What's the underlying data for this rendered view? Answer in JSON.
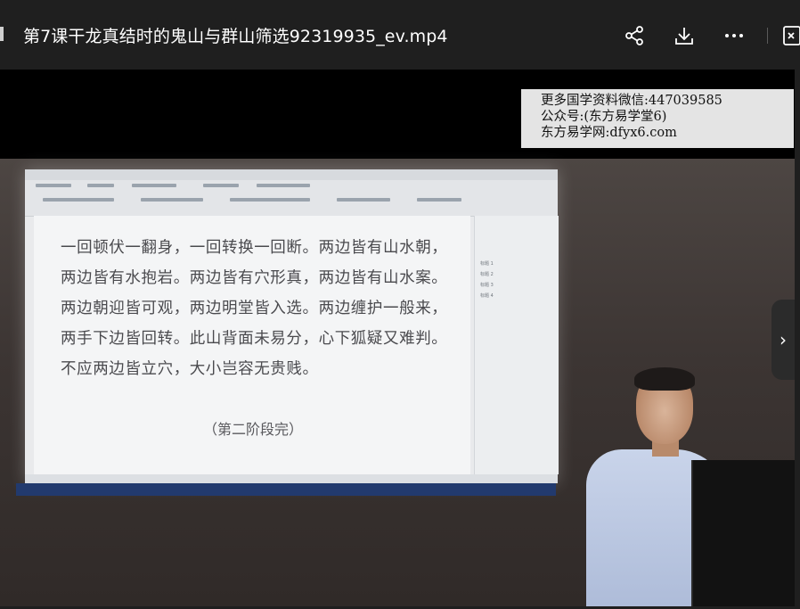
{
  "window": {
    "title": "第7课干龙真结时的鬼山与群山筛选92319935_ev.mp4",
    "actions": [
      {
        "name": "share",
        "icon": "share-icon"
      },
      {
        "name": "download",
        "icon": "download-icon"
      },
      {
        "name": "more",
        "icon": "more-icon"
      },
      {
        "name": "exit",
        "icon": "exit-icon"
      }
    ]
  },
  "video": {
    "watermark": {
      "line1": "更多国学资料微信:447039585",
      "line2": "公众号:(东方易学堂6)",
      "line3": "东方易学网:dfyx6.com"
    },
    "document_text": {
      "line1": "一回顿伏一翻身，一回转换一回断。两边皆有山水朝，",
      "line2": "两边皆有水抱岩。两边皆有穴形真，两边皆有山水案。",
      "line3": "两边朝迎皆可观，两边明堂皆入选。两边缠护一般来，",
      "line4": "两手下边皆回转。此山背面未易分，心下狐疑又难判。",
      "line5": "不应两边皆立穴，大小岂容无贵贱。",
      "footer": "（第二阶段完）"
    },
    "side_panel": {
      "headings": [
        "标题 1",
        "标题 2",
        "标题 3",
        "标题 4"
      ]
    },
    "next_arrow": "›"
  },
  "colors": {
    "titlebar_bg": "#1f1f1f",
    "title_text": "#ffffff",
    "watermark_bg": "#e4e4e4"
  }
}
